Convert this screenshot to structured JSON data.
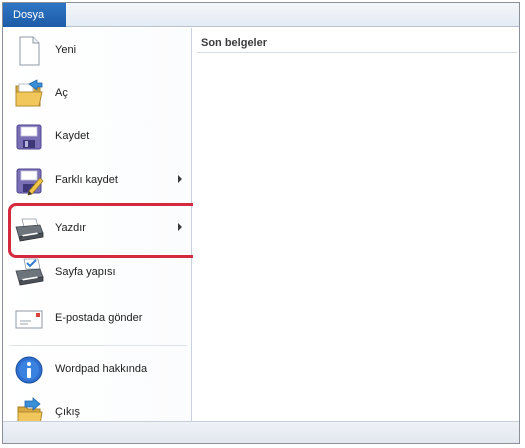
{
  "file_tab": {
    "label": "Dosya"
  },
  "menu": {
    "items": [
      {
        "label": "Yeni",
        "icon": "new-document-icon",
        "has_submenu": false
      },
      {
        "label": "Aç",
        "icon": "open-folder-icon",
        "has_submenu": false
      },
      {
        "label": "Kaydet",
        "icon": "save-icon",
        "has_submenu": false
      },
      {
        "label": "Farklı kaydet",
        "icon": "save-as-icon",
        "has_submenu": true
      },
      {
        "label": "Yazdır",
        "icon": "printer-icon",
        "has_submenu": true
      },
      {
        "label": "Sayfa yapısı",
        "icon": "page-setup-icon",
        "has_submenu": false
      },
      {
        "label": "E-postada gönder",
        "icon": "email-icon",
        "has_submenu": false
      },
      {
        "label": "Wordpad hakkında",
        "icon": "info-icon",
        "has_submenu": false
      },
      {
        "label": "Çıkış",
        "icon": "exit-icon",
        "has_submenu": false
      }
    ]
  },
  "recent": {
    "title": "Son belgeler"
  },
  "highlight_color": "#d32a3e",
  "accent_color": "#2f76c4"
}
